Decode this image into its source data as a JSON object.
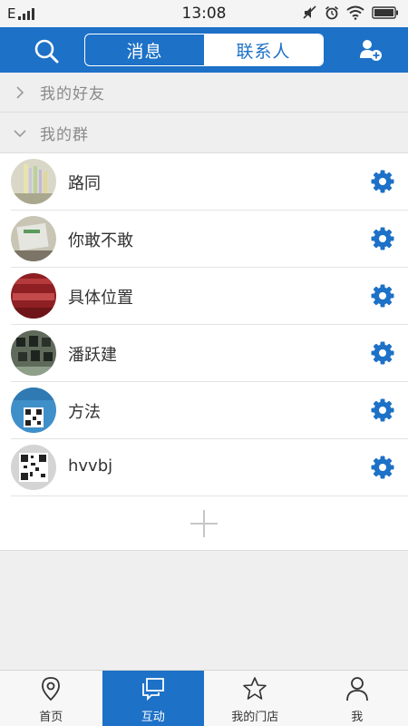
{
  "status_bar": {
    "network": "E",
    "time": "13:08",
    "icons": [
      "signal-bars-icon",
      "mute-icon",
      "alarm-icon",
      "wifi-icon",
      "battery-icon"
    ]
  },
  "header": {
    "search_icon": "search-icon",
    "tabs": [
      {
        "label": "消息",
        "active": false
      },
      {
        "label": "联系人",
        "active": true
      }
    ],
    "add_contact_icon": "add-contact-icon"
  },
  "groups": [
    {
      "label": "我的好友",
      "expanded": false
    },
    {
      "label": "我的群",
      "expanded": true
    }
  ],
  "contacts": [
    {
      "name": "路同"
    },
    {
      "name": "你敢不敢"
    },
    {
      "name": "具体位置"
    },
    {
      "name": "潘跃建"
    },
    {
      "name": "方法"
    },
    {
      "name": "hvvbj"
    }
  ],
  "bottom_nav": [
    {
      "label": "首页",
      "icon": "location-pin-icon",
      "active": false
    },
    {
      "label": "互动",
      "icon": "chat-icon",
      "active": true
    },
    {
      "label": "我的门店",
      "icon": "star-icon",
      "active": false
    },
    {
      "label": "我",
      "icon": "person-icon",
      "active": false
    }
  ],
  "colors": {
    "accent": "#1d71c7",
    "background": "#efeff0"
  }
}
